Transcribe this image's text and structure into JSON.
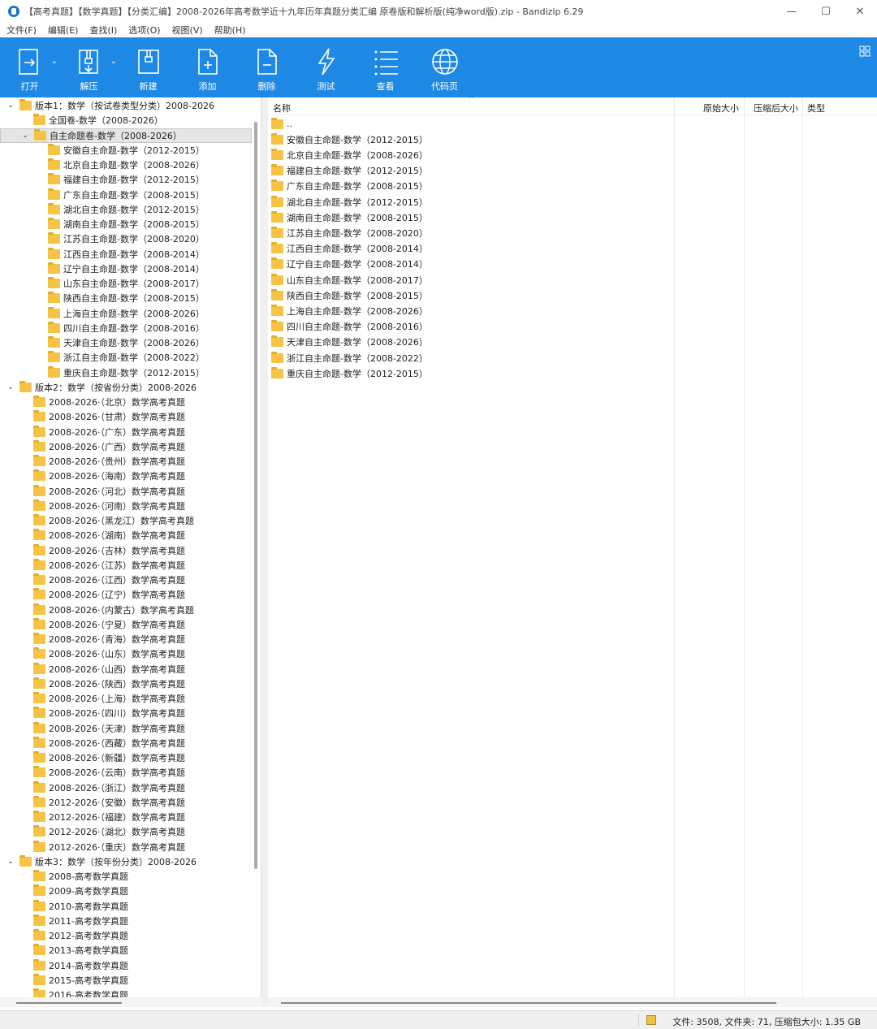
{
  "window": {
    "title": "【高考真题】【数学真题】【分类汇编】2008-2026年高考数学近十九年历年真题分类汇编 原卷版和解析版(纯净word版).zip - Bandizip 6.29",
    "minimize": "—",
    "maximize": "☐",
    "close": "✕"
  },
  "menu": [
    "文件(F)",
    "编辑(E)",
    "查找(I)",
    "选项(O)",
    "视图(V)",
    "帮助(H)"
  ],
  "toolbar": {
    "open": "打开",
    "extract": "解压",
    "new": "新建",
    "add": "添加",
    "delete": "删除",
    "test": "测试",
    "view": "查看",
    "codepage": "代码页"
  },
  "tree": [
    {
      "label": "版本1：数学（按试卷类型分类）2008-2026",
      "level": 0,
      "toggle": "open"
    },
    {
      "label": "全国卷-数学（2008-2026）",
      "level": 1
    },
    {
      "label": "自主命题卷-数学（2008-2026）",
      "level": 1,
      "toggle": "open",
      "selected": true
    },
    {
      "label": "安徽自主命题-数学（2012-2015）",
      "level": 2
    },
    {
      "label": "北京自主命题-数学（2008-2026）",
      "level": 2
    },
    {
      "label": "福建自主命题-数学（2012-2015）",
      "level": 2
    },
    {
      "label": "广东自主命题-数学（2008-2015）",
      "level": 2
    },
    {
      "label": "湖北自主命题-数学（2012-2015）",
      "level": 2
    },
    {
      "label": "湖南自主命题-数学（2008-2015）",
      "level": 2
    },
    {
      "label": "江苏自主命题-数学（2008-2020）",
      "level": 2
    },
    {
      "label": "江西自主命题-数学（2008-2014）",
      "level": 2
    },
    {
      "label": "辽宁自主命题-数学（2008-2014）",
      "level": 2
    },
    {
      "label": "山东自主命题-数学（2008-2017）",
      "level": 2
    },
    {
      "label": "陕西自主命题-数学（2008-2015）",
      "level": 2
    },
    {
      "label": "上海自主命题-数学（2008-2026）",
      "level": 2
    },
    {
      "label": "四川自主命题-数学（2008-2016）",
      "level": 2
    },
    {
      "label": "天津自主命题-数学（2008-2026）",
      "level": 2
    },
    {
      "label": "浙江自主命题-数学（2008-2022）",
      "level": 2
    },
    {
      "label": "重庆自主命题-数学（2012-2015）",
      "level": 2
    },
    {
      "label": "版本2：数学（按省份分类）2008-2026",
      "level": 0,
      "toggle": "open"
    },
    {
      "label": "2008-2026·（北京）数学高考真题",
      "level": 1
    },
    {
      "label": "2008-2026·（甘肃）数学高考真题",
      "level": 1
    },
    {
      "label": "2008-2026·（广东）数学高考真题",
      "level": 1
    },
    {
      "label": "2008-2026·（广西）数学高考真题",
      "level": 1
    },
    {
      "label": "2008-2026·（贵州）数学高考真题",
      "level": 1
    },
    {
      "label": "2008-2026·（海南）数学高考真题",
      "level": 1
    },
    {
      "label": "2008-2026·（河北）数学高考真题",
      "level": 1
    },
    {
      "label": "2008-2026·（河南）数学高考真题",
      "level": 1
    },
    {
      "label": "2008-2026·（黑龙江）数学高考真题",
      "level": 1
    },
    {
      "label": "2008-2026·（湖南）数学高考真题",
      "level": 1
    },
    {
      "label": "2008-2026·（吉林）数学高考真题",
      "level": 1
    },
    {
      "label": "2008-2026·（江苏）数学高考真题",
      "level": 1
    },
    {
      "label": "2008-2026·（江西）数学高考真题",
      "level": 1
    },
    {
      "label": "2008-2026·（辽宁）数学高考真题",
      "level": 1
    },
    {
      "label": "2008-2026·（内蒙古）数学高考真题",
      "level": 1
    },
    {
      "label": "2008-2026·（宁夏）数学高考真题",
      "level": 1
    },
    {
      "label": "2008-2026·（青海）数学高考真题",
      "level": 1
    },
    {
      "label": "2008-2026·（山东）数学高考真题",
      "level": 1
    },
    {
      "label": "2008-2026·（山西）数学高考真题",
      "level": 1
    },
    {
      "label": "2008-2026·（陕西）数学高考真题",
      "level": 1
    },
    {
      "label": "2008-2026·（上海）数学高考真题",
      "level": 1
    },
    {
      "label": "2008-2026·（四川）数学高考真题",
      "level": 1
    },
    {
      "label": "2008-2026·（天津）数学高考真题",
      "level": 1
    },
    {
      "label": "2008-2026·（西藏）数学高考真题",
      "level": 1
    },
    {
      "label": "2008-2026·（新疆）数学高考真题",
      "level": 1
    },
    {
      "label": "2008-2026·（云南）数学高考真题",
      "level": 1
    },
    {
      "label": "2008-2026·（浙江）数学高考真题",
      "level": 1
    },
    {
      "label": "2012-2026·（安徽）数学高考真题",
      "level": 1
    },
    {
      "label": "2012-2026·（福建）数学高考真题",
      "level": 1
    },
    {
      "label": "2012-2026·（湖北）数学高考真题",
      "level": 1
    },
    {
      "label": "2012-2026·（重庆）数学高考真题",
      "level": 1
    },
    {
      "label": "版本3：数学（按年份分类）2008-2026",
      "level": 0,
      "toggle": "open"
    },
    {
      "label": "2008-高考数学真题",
      "level": 1
    },
    {
      "label": "2009-高考数学真题",
      "level": 1
    },
    {
      "label": "2010-高考数学真题",
      "level": 1
    },
    {
      "label": "2011-高考数学真题",
      "level": 1
    },
    {
      "label": "2012-高考数学真题",
      "level": 1
    },
    {
      "label": "2013-高考数学真题",
      "level": 1
    },
    {
      "label": "2014-高考数学真题",
      "level": 1
    },
    {
      "label": "2015-高考数学真题",
      "level": 1
    },
    {
      "label": "2016-高考数学真题",
      "level": 1
    }
  ],
  "list": {
    "columns": {
      "name": "名称",
      "original_size": "原始大小",
      "compressed_size": "压缩后大小",
      "type": "类型"
    },
    "items": [
      "..",
      "安徽自主命题-数学（2012-2015）",
      "北京自主命题-数学（2008-2026）",
      "福建自主命题-数学（2012-2015）",
      "广东自主命题-数学（2008-2015）",
      "湖北自主命题-数学（2012-2015）",
      "湖南自主命题-数学（2008-2015）",
      "江苏自主命题-数学（2008-2020）",
      "江西自主命题-数学（2008-2014）",
      "辽宁自主命题-数学（2008-2014）",
      "山东自主命题-数学（2008-2017）",
      "陕西自主命题-数学（2008-2015）",
      "上海自主命题-数学（2008-2026）",
      "四川自主命题-数学（2008-2016）",
      "天津自主命题-数学（2008-2026）",
      "浙江自主命题-数学（2008-2022）",
      "重庆自主命题-数学（2012-2015）"
    ]
  },
  "status": {
    "text": "文件: 3508, 文件夹: 71, 压缩包大小: 1.35 GB"
  },
  "colors": {
    "toolbar": "#1e88e5",
    "folder": "#f6c445"
  }
}
